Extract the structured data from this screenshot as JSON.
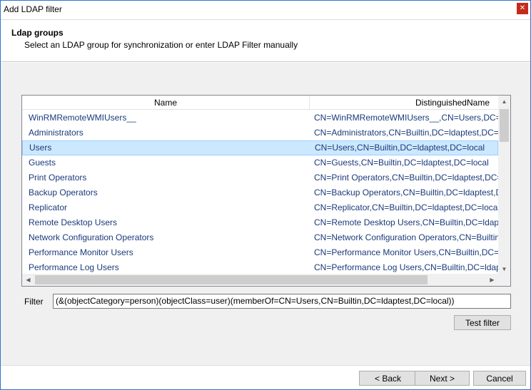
{
  "window": {
    "title": "Add LDAP filter",
    "close_glyph": "✕"
  },
  "header": {
    "title": "Ldap groups",
    "subtitle": "Select an LDAP group for synchronization or enter LDAP Filter manually"
  },
  "table": {
    "columns": [
      "Name",
      "DistinguishedName"
    ],
    "rows": [
      {
        "name": "WinRMRemoteWMIUsers__",
        "dn": "CN=WinRMRemoteWMIUsers__,CN=Users,DC=ldaptest,DC=local",
        "selected": false
      },
      {
        "name": "Administrators",
        "dn": "CN=Administrators,CN=Builtin,DC=ldaptest,DC=local",
        "selected": false
      },
      {
        "name": "Users",
        "dn": "CN=Users,CN=Builtin,DC=ldaptest,DC=local",
        "selected": true
      },
      {
        "name": "Guests",
        "dn": "CN=Guests,CN=Builtin,DC=ldaptest,DC=local",
        "selected": false
      },
      {
        "name": "Print Operators",
        "dn": "CN=Print Operators,CN=Builtin,DC=ldaptest,DC=local",
        "selected": false
      },
      {
        "name": "Backup Operators",
        "dn": "CN=Backup Operators,CN=Builtin,DC=ldaptest,DC=local",
        "selected": false
      },
      {
        "name": "Replicator",
        "dn": "CN=Replicator,CN=Builtin,DC=ldaptest,DC=local",
        "selected": false
      },
      {
        "name": "Remote Desktop Users",
        "dn": "CN=Remote Desktop Users,CN=Builtin,DC=ldaptest,DC=local",
        "selected": false
      },
      {
        "name": "Network Configuration Operators",
        "dn": "CN=Network Configuration Operators,CN=Builtin,DC=ldaptest,DC=local",
        "selected": false
      },
      {
        "name": "Performance Monitor Users",
        "dn": "CN=Performance Monitor Users,CN=Builtin,DC=ldaptest,DC=local",
        "selected": false
      },
      {
        "name": "Performance Log Users",
        "dn": "CN=Performance Log Users,CN=Builtin,DC=ldaptest,DC=local",
        "selected": false
      }
    ]
  },
  "filter": {
    "label": "Filter",
    "value": "(&(objectCategory=person)(objectClass=user)(memberOf=CN=Users,CN=Builtin,DC=ldaptest,DC=local))",
    "test_button": "Test filter"
  },
  "footer": {
    "back_button": "< Back",
    "next_button": "Next >",
    "cancel_button": "Cancel"
  },
  "colors": {
    "selection_bg": "#cce8ff",
    "selection_border": "#99d1ff",
    "link_text": "#1a3a7a",
    "close_button": "#c42b1c"
  }
}
